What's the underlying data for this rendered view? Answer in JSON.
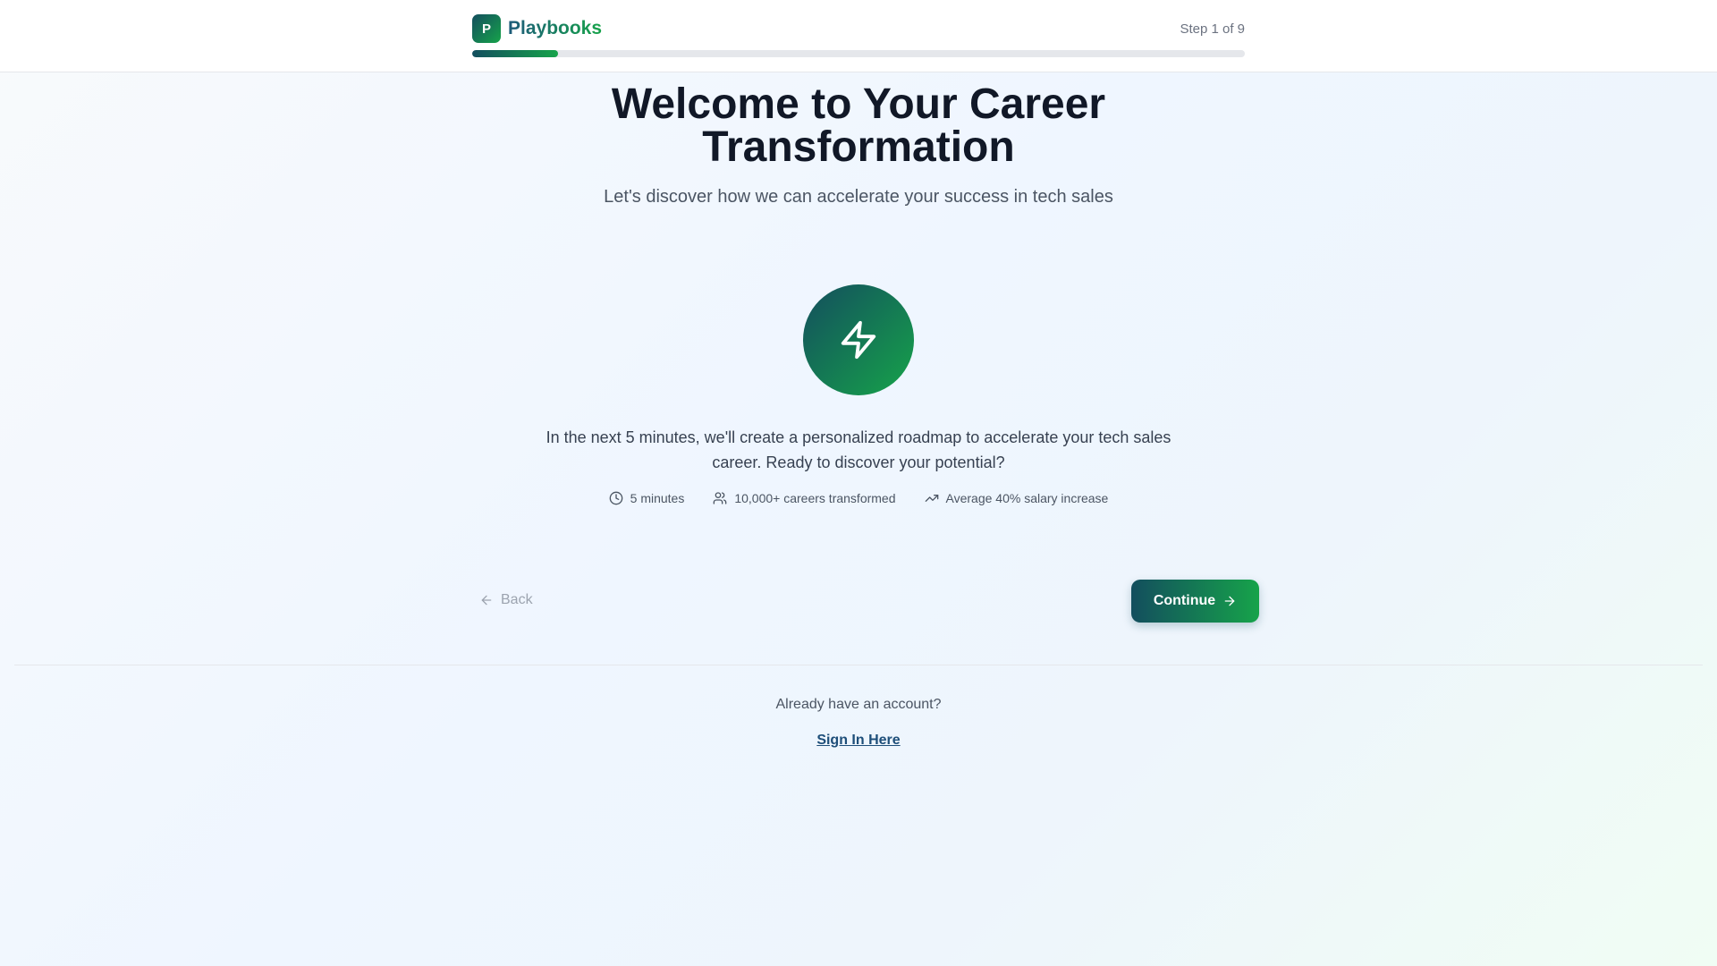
{
  "header": {
    "logo_letter": "P",
    "brand_name": "Playbooks",
    "step_label": "Step 1 of 9",
    "progress_fraction": 0.111
  },
  "main": {
    "title": "Welcome to Your Career Transformation",
    "subtitle": "Let's discover how we can accelerate your success in tech sales",
    "hero_icon": "lightning-bolt-icon",
    "description": "In the next 5 minutes, we'll create a personalized roadmap to accelerate your tech sales career. Ready to discover your potential?",
    "stats": [
      {
        "icon": "clock-icon",
        "label": "5 minutes"
      },
      {
        "icon": "users-icon",
        "label": "10,000+ careers transformed"
      },
      {
        "icon": "trending-up-icon",
        "label": "Average 40% salary increase"
      }
    ]
  },
  "nav": {
    "back_label": "Back",
    "continue_label": "Continue"
  },
  "footer": {
    "account_prompt": "Already have an account?",
    "signin_label": "Sign In Here"
  },
  "colors": {
    "brand_dark": "#134e5e",
    "brand_green": "#16a34a",
    "link": "#1d4e79"
  }
}
